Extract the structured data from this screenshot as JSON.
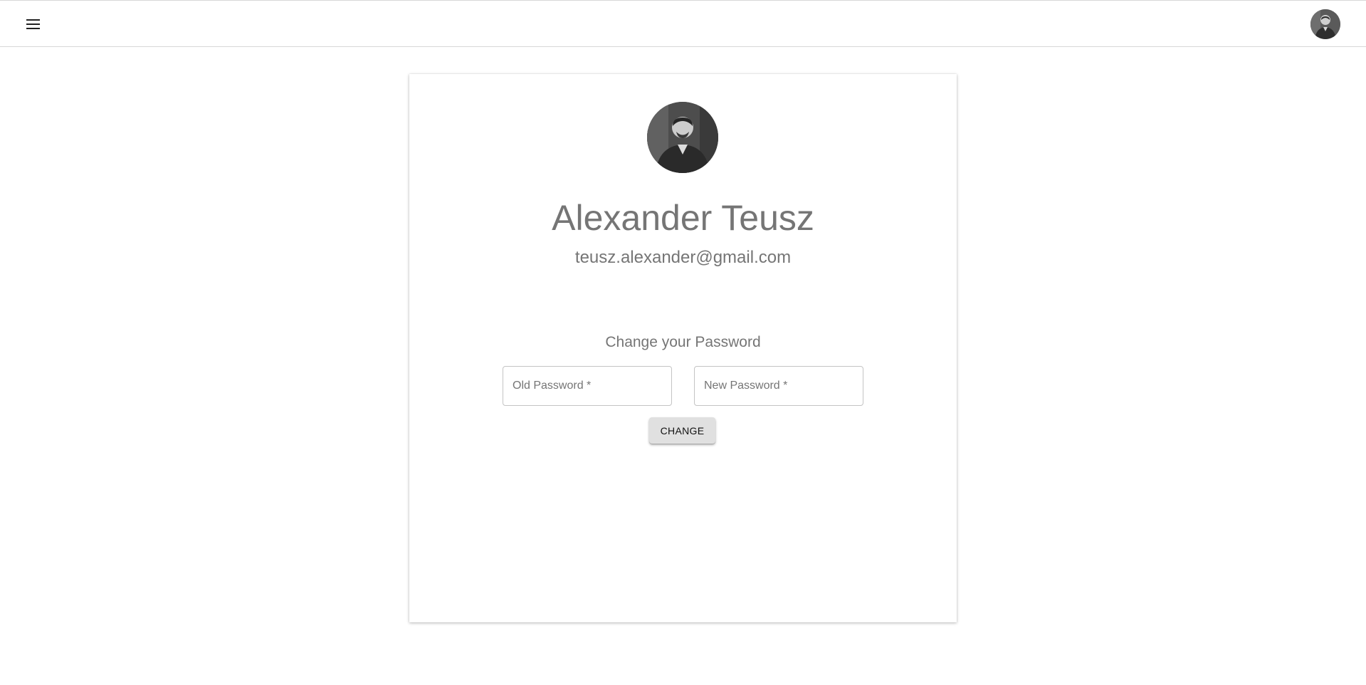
{
  "header": {
    "menu_icon": "hamburger-menu-icon",
    "avatar_icon": "user-avatar-photo"
  },
  "profile": {
    "avatar_icon": "user-avatar-photo",
    "name": "Alexander Teusz",
    "email": "teusz.alexander@gmail.com"
  },
  "change_password": {
    "title": "Change your Password",
    "old_password_placeholder": "Old Password *",
    "new_password_placeholder": "New Password *",
    "submit_label": "CHANGE"
  }
}
